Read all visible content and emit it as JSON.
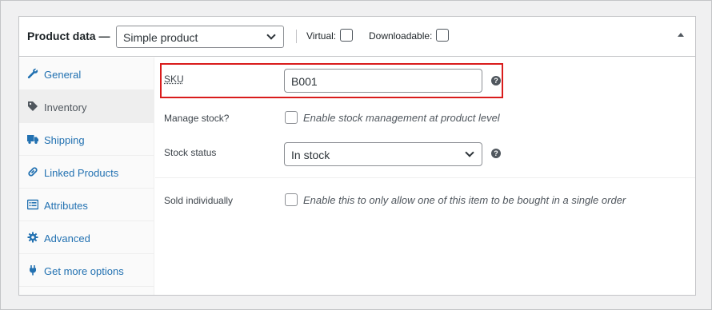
{
  "header": {
    "title": "Product data —",
    "product_type": "Simple product",
    "virtual_label": "Virtual:",
    "downloadable_label": "Downloadable:"
  },
  "sidebar": {
    "items": [
      {
        "label": "General",
        "icon": "wrench-icon"
      },
      {
        "label": "Inventory",
        "icon": "tag-icon"
      },
      {
        "label": "Shipping",
        "icon": "truck-icon"
      },
      {
        "label": "Linked Products",
        "icon": "link-icon"
      },
      {
        "label": "Attributes",
        "icon": "list-icon"
      },
      {
        "label": "Advanced",
        "icon": "gear-icon"
      },
      {
        "label": "Get more options",
        "icon": "plugin-icon"
      }
    ],
    "active": "Inventory"
  },
  "inventory": {
    "sku_label": "SKU",
    "sku_value": "B001",
    "manage_stock_label": "Manage stock?",
    "manage_stock_desc": "Enable stock management at product level",
    "stock_status_label": "Stock status",
    "stock_status_value": "In stock",
    "sold_individually_label": "Sold individually",
    "sold_individually_desc": "Enable this to only allow one of this item to be bought in a single order"
  },
  "colors": {
    "link": "#2271b1",
    "highlight_border": "#d91c1c"
  }
}
